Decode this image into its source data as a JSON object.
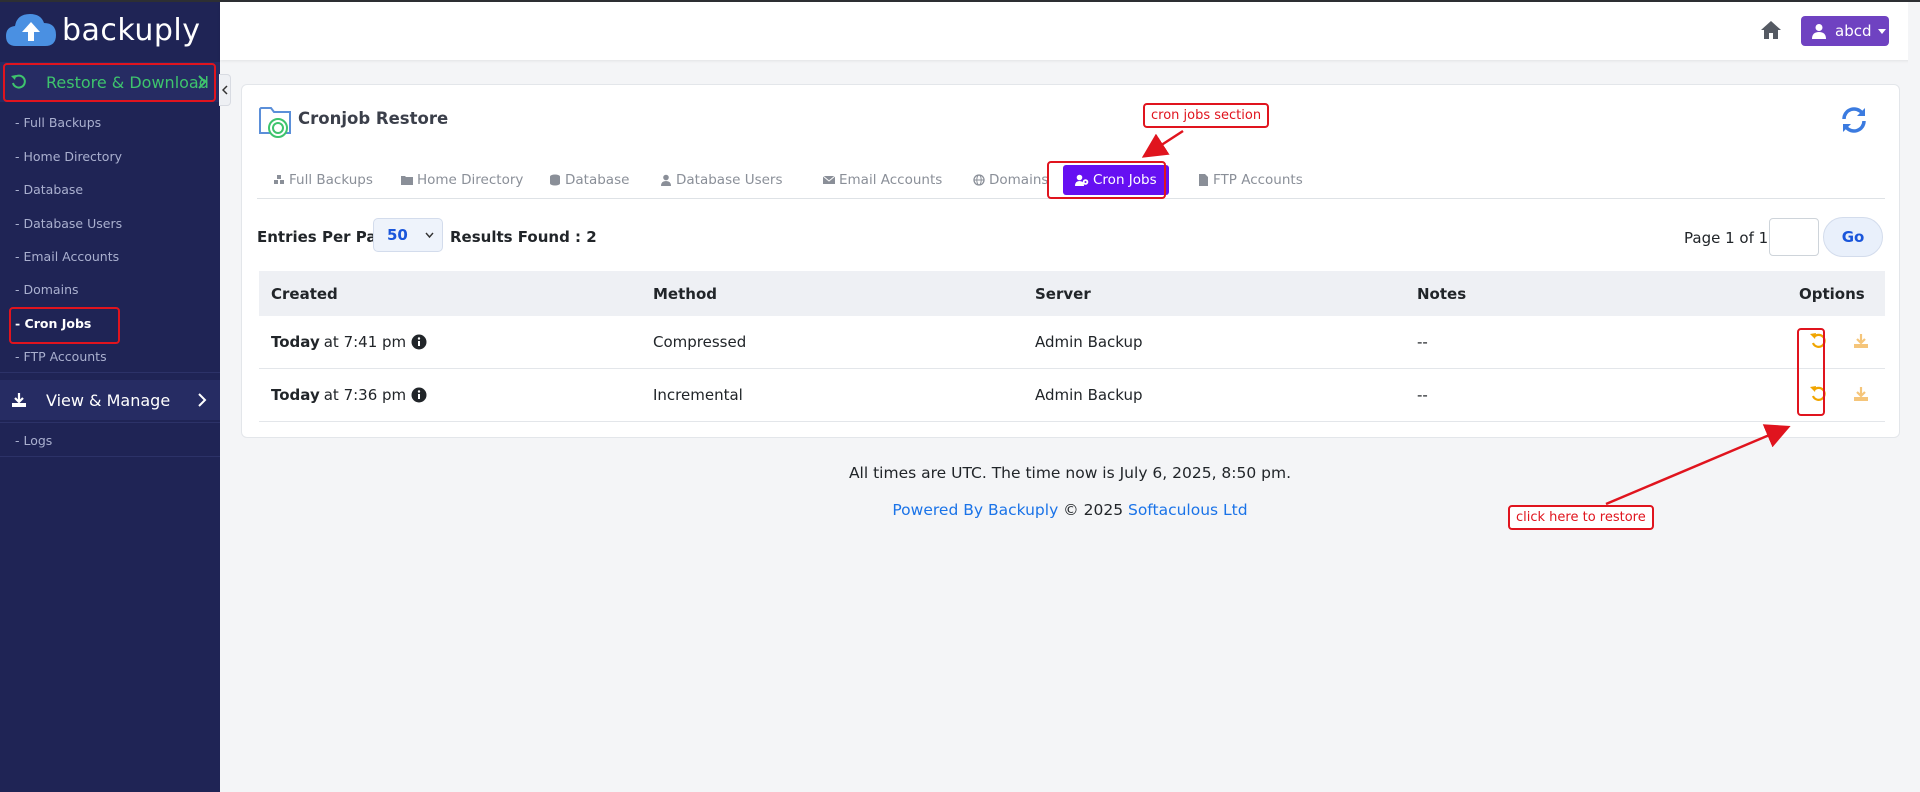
{
  "brand": {
    "name": "backuply"
  },
  "sidebar": {
    "restore_header": "Restore & Download",
    "restore_items": [
      {
        "label": "- Full Backups"
      },
      {
        "label": "- Home Directory"
      },
      {
        "label": "- Database"
      },
      {
        "label": "- Database Users"
      },
      {
        "label": "- Email Accounts"
      },
      {
        "label": "- Domains"
      },
      {
        "label": "- Cron Jobs",
        "active": true
      },
      {
        "label": "- FTP Accounts"
      }
    ],
    "view_header": "View & Manage",
    "view_items": [
      {
        "label": "- Logs"
      }
    ]
  },
  "topbar": {
    "user": "abcd",
    "home_icon": "home-icon",
    "user_icon": "user-icon"
  },
  "card": {
    "title": "Cronjob Restore",
    "tabs": [
      {
        "label": "Full Backups",
        "icon": "cubes-icon"
      },
      {
        "label": "Home Directory",
        "icon": "folder-icon"
      },
      {
        "label": "Database",
        "icon": "database-icon"
      },
      {
        "label": "Database Users",
        "icon": "user-icon"
      },
      {
        "label": "Email Accounts",
        "icon": "envelope-icon"
      },
      {
        "label": "Domains",
        "icon": "globe-icon"
      },
      {
        "label": "Cron Jobs",
        "icon": "users-cog-icon",
        "active": true
      },
      {
        "label": "FTP Accounts",
        "icon": "file-icon"
      }
    ],
    "entries_label": "Entries Per Page",
    "entries_value": "50",
    "results": "Results Found : 2",
    "page_info": "Page 1 of 1",
    "go_label": "Go"
  },
  "table": {
    "headers": [
      "Created",
      "Method",
      "Server",
      "Notes",
      "Options"
    ],
    "rows": [
      {
        "day": "Today",
        "time": "at 7:41 pm",
        "method": "Compressed",
        "server": "Admin Backup",
        "notes": "--"
      },
      {
        "day": "Today",
        "time": "at 7:36 pm",
        "method": "Incremental",
        "server": "Admin Backup",
        "notes": "--"
      }
    ]
  },
  "footer": {
    "time_note": "All times are UTC. The time now is July 6, 2025, 8:50 pm.",
    "powered_by": "Powered By Backuply",
    "copyright": " © 2025 ",
    "company": "Softaculous Ltd"
  },
  "annotations": {
    "cron_section": "cron jobs section",
    "restore_hint": "click here to restore"
  },
  "colors": {
    "sidebar_bg": "#1f2455",
    "accent_green": "#3ec46d",
    "active_tab": "#6610f2",
    "user_btn": "#6f42c1",
    "restore_icon": "#f0a500",
    "annotation_red": "#e0141e"
  }
}
